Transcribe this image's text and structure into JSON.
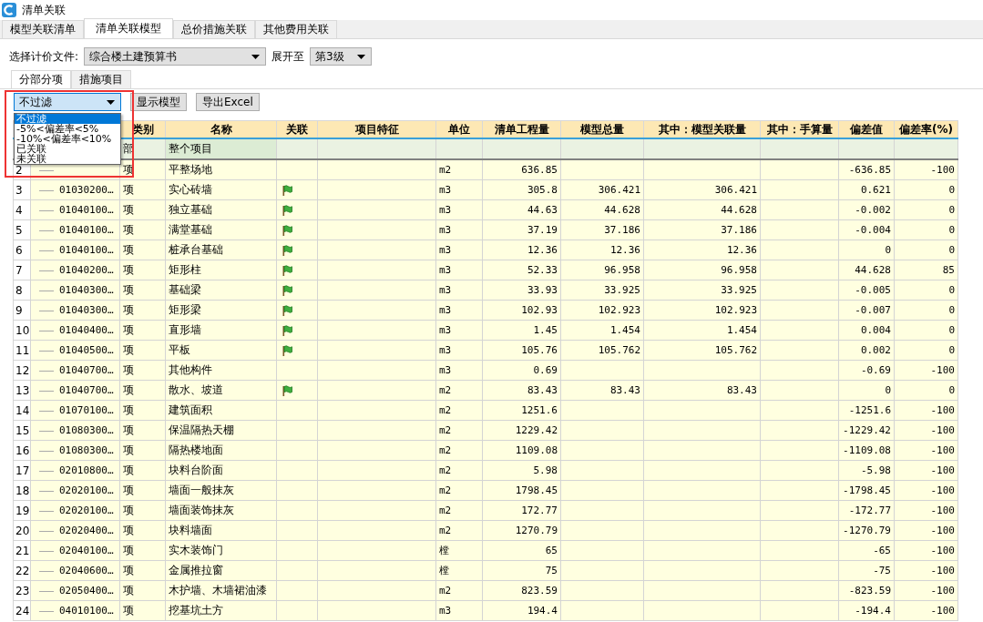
{
  "window": {
    "title": "清单关联"
  },
  "tabs": [
    {
      "label": "模型关联清单",
      "selected": false
    },
    {
      "label": "清单关联模型",
      "selected": true
    },
    {
      "label": "总价措施关联",
      "selected": false
    },
    {
      "label": "其他费用关联",
      "selected": false
    }
  ],
  "file_select": {
    "label": "选择计价文件:",
    "value": "综合楼土建预算书"
  },
  "expand_select": {
    "label": "展开至",
    "value": "第3级"
  },
  "sub_tabs": [
    {
      "label": "分部分项",
      "selected": true
    },
    {
      "label": "措施项目",
      "selected": false
    }
  ],
  "filter": {
    "value": "不过滤",
    "expanded": true,
    "options": [
      {
        "label": "不过滤",
        "selected": true
      },
      {
        "label": "-5%<偏差率<5%",
        "selected": false
      },
      {
        "label": "-10%<偏差率<10%",
        "selected": false
      },
      {
        "label": "已关联",
        "selected": false
      },
      {
        "label": "未关联",
        "selected": false
      }
    ]
  },
  "buttons": [
    "显示模型",
    "导出Excel"
  ],
  "table": {
    "columns": [
      "类别",
      "名称",
      "关联",
      "项目特征",
      "单位",
      "清单工程量",
      "模型总量",
      "其中：模型关联量",
      "其中：手算量",
      "偏差值",
      "偏差率(%)"
    ],
    "rows": [
      {
        "kind": "group",
        "type": "部",
        "name": "整个项目",
        "linked": false
      },
      {
        "kind": "item",
        "num": "2",
        "type": "项",
        "name": "平整场地",
        "linked": false,
        "unit": "m2",
        "qty": "636.85",
        "deviation": "-636.85",
        "rate": "-100"
      },
      {
        "kind": "item",
        "num": "3",
        "code": "01030200…",
        "type": "项",
        "name": "实心砖墙",
        "linked": true,
        "unit": "m3",
        "qty": "305.8",
        "model_total": "306.421",
        "model_linked": "306.421",
        "deviation": "0.621",
        "rate": "0"
      },
      {
        "kind": "item",
        "num": "4",
        "code": "01040100…",
        "type": "项",
        "name": "独立基础",
        "linked": true,
        "unit": "m3",
        "qty": "44.63",
        "model_total": "44.628",
        "model_linked": "44.628",
        "deviation": "-0.002",
        "rate": "0"
      },
      {
        "kind": "item",
        "num": "5",
        "code": "01040100…",
        "type": "项",
        "name": "满堂基础",
        "linked": true,
        "unit": "m3",
        "qty": "37.19",
        "model_total": "37.186",
        "model_linked": "37.186",
        "deviation": "-0.004",
        "rate": "0"
      },
      {
        "kind": "item",
        "num": "6",
        "code": "01040100…",
        "type": "项",
        "name": "桩承台基础",
        "linked": true,
        "unit": "m3",
        "qty": "12.36",
        "model_total": "12.36",
        "model_linked": "12.36",
        "deviation": "0",
        "rate": "0"
      },
      {
        "kind": "item",
        "num": "7",
        "code": "01040200…",
        "type": "项",
        "name": "矩形柱",
        "linked": true,
        "unit": "m3",
        "qty": "52.33",
        "model_total": "96.958",
        "model_linked": "96.958",
        "deviation": "44.628",
        "rate": "85"
      },
      {
        "kind": "item",
        "num": "8",
        "code": "01040300…",
        "type": "项",
        "name": "基础梁",
        "linked": true,
        "unit": "m3",
        "qty": "33.93",
        "model_total": "33.925",
        "model_linked": "33.925",
        "deviation": "-0.005",
        "rate": "0"
      },
      {
        "kind": "item",
        "num": "9",
        "code": "01040300…",
        "type": "项",
        "name": "矩形梁",
        "linked": true,
        "unit": "m3",
        "qty": "102.93",
        "model_total": "102.923",
        "model_linked": "102.923",
        "deviation": "-0.007",
        "rate": "0"
      },
      {
        "kind": "item",
        "num": "10",
        "code": "01040400…",
        "type": "项",
        "name": "直形墙",
        "linked": true,
        "unit": "m3",
        "qty": "1.45",
        "model_total": "1.454",
        "model_linked": "1.454",
        "deviation": "0.004",
        "rate": "0"
      },
      {
        "kind": "item",
        "num": "11",
        "code": "01040500…",
        "type": "项",
        "name": "平板",
        "linked": true,
        "unit": "m3",
        "qty": "105.76",
        "model_total": "105.762",
        "model_linked": "105.762",
        "deviation": "0.002",
        "rate": "0"
      },
      {
        "kind": "item",
        "num": "12",
        "code": "01040700…",
        "type": "项",
        "name": "其他构件",
        "linked": false,
        "unit": "m3",
        "qty": "0.69",
        "deviation": "-0.69",
        "rate": "-100"
      },
      {
        "kind": "item",
        "num": "13",
        "code": "01040700…",
        "type": "项",
        "name": "散水、坡道",
        "linked": true,
        "unit": "m2",
        "qty": "83.43",
        "model_total": "83.43",
        "model_linked": "83.43",
        "deviation": "0",
        "rate": "0"
      },
      {
        "kind": "item",
        "num": "14",
        "code": "01070100…",
        "type": "项",
        "name": "建筑面积",
        "linked": false,
        "unit": "m2",
        "qty": "1251.6",
        "deviation": "-1251.6",
        "rate": "-100"
      },
      {
        "kind": "item",
        "num": "15",
        "code": "01080300…",
        "type": "项",
        "name": "保温隔热天棚",
        "linked": false,
        "unit": "m2",
        "qty": "1229.42",
        "deviation": "-1229.42",
        "rate": "-100"
      },
      {
        "kind": "item",
        "num": "16",
        "code": "01080300…",
        "type": "项",
        "name": "隔热楼地面",
        "linked": false,
        "unit": "m2",
        "qty": "1109.08",
        "deviation": "-1109.08",
        "rate": "-100"
      },
      {
        "kind": "item",
        "num": "17",
        "code": "02010800…",
        "type": "项",
        "name": "块料台阶面",
        "linked": false,
        "unit": "m2",
        "qty": "5.98",
        "deviation": "-5.98",
        "rate": "-100"
      },
      {
        "kind": "item",
        "num": "18",
        "code": "02020100…",
        "type": "项",
        "name": "墙面一般抹灰",
        "linked": false,
        "unit": "m2",
        "qty": "1798.45",
        "deviation": "-1798.45",
        "rate": "-100"
      },
      {
        "kind": "item",
        "num": "19",
        "code": "02020100…",
        "type": "项",
        "name": "墙面装饰抹灰",
        "linked": false,
        "unit": "m2",
        "qty": "172.77",
        "deviation": "-172.77",
        "rate": "-100"
      },
      {
        "kind": "item",
        "num": "20",
        "code": "02020400…",
        "type": "项",
        "name": "块料墙面",
        "linked": false,
        "unit": "m2",
        "qty": "1270.79",
        "deviation": "-1270.79",
        "rate": "-100"
      },
      {
        "kind": "item",
        "num": "21",
        "code": "02040100…",
        "type": "项",
        "name": "实木装饰门",
        "linked": false,
        "unit": "樘",
        "qty": "65",
        "deviation": "-65",
        "rate": "-100"
      },
      {
        "kind": "item",
        "num": "22",
        "code": "02040600…",
        "type": "项",
        "name": "金属推拉窗",
        "linked": false,
        "unit": "樘",
        "qty": "75",
        "deviation": "-75",
        "rate": "-100"
      },
      {
        "kind": "item",
        "num": "23",
        "code": "02050400…",
        "type": "项",
        "name": "木护墙、木墙裙油漆",
        "linked": false,
        "unit": "m2",
        "qty": "823.59",
        "deviation": "-823.59",
        "rate": "-100"
      },
      {
        "kind": "item",
        "num": "24",
        "code": "04010100…",
        "type": "项",
        "name": "挖基坑土方",
        "linked": false,
        "unit": "m3",
        "qty": "194.4",
        "deviation": "-194.4",
        "rate": "-100"
      }
    ]
  }
}
